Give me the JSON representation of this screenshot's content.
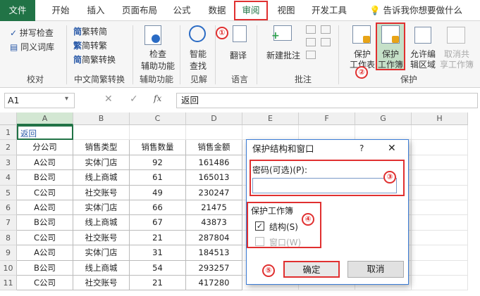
{
  "tabs": [
    "文件",
    "开始",
    "插入",
    "页面布局",
    "公式",
    "数据",
    "审阅",
    "视图",
    "开发工具"
  ],
  "tell_me": "告诉我你想要做什么",
  "ribbon": {
    "proofing": {
      "spell": "拼写检查",
      "thesaurus": "同义词库",
      "group": "校对"
    },
    "chinese": {
      "to_simplified": "繁转简",
      "to_traditional": "简转繁",
      "convert": "简繁转换",
      "group": "中文简繁转换"
    },
    "accessibility": {
      "label1": "检查",
      "label2": "辅助功能",
      "group": "辅助功能"
    },
    "insights": {
      "label1": "智能",
      "label2": "查找",
      "group": "见解"
    },
    "language": {
      "label": "翻译",
      "group": "语言"
    },
    "comments": {
      "label": "新建批注",
      "group": "批注"
    },
    "protect": {
      "sheet1": "保护",
      "sheet2": "工作表",
      "book1": "保护",
      "book2": "工作簿",
      "range1": "允许编",
      "range2": "辑区域",
      "unshare1": "取消共",
      "unshare2": "享工作簿",
      "group": "保护"
    }
  },
  "annotations": {
    "c1": "①",
    "c2": "②",
    "c3": "③",
    "c4": "④",
    "c5": "⑤"
  },
  "formula_bar": {
    "name_box": "A1",
    "fx": "fx",
    "value": "返回"
  },
  "columns": [
    "A",
    "B",
    "C",
    "D",
    "E",
    "F",
    "G",
    "H"
  ],
  "rows": [
    [
      "1",
      "返回",
      "",
      "",
      ""
    ],
    [
      "2",
      "分公司",
      "销售类型",
      "销售数量",
      "销售金额"
    ],
    [
      "3",
      "A公司",
      "实体门店",
      "92",
      "161486"
    ],
    [
      "4",
      "B公司",
      "线上商城",
      "61",
      "165013"
    ],
    [
      "5",
      "C公司",
      "社交账号",
      "49",
      "230247"
    ],
    [
      "6",
      "A公司",
      "实体门店",
      "66",
      "21475"
    ],
    [
      "7",
      "B公司",
      "线上商城",
      "67",
      "43873"
    ],
    [
      "8",
      "C公司",
      "社交账号",
      "21",
      "287804"
    ],
    [
      "9",
      "A公司",
      "实体门店",
      "31",
      "184513"
    ],
    [
      "10",
      "B公司",
      "线上商城",
      "54",
      "293257"
    ],
    [
      "11",
      "C公司",
      "社交账号",
      "21",
      "417280"
    ]
  ],
  "dialog": {
    "title": "保护结构和窗口",
    "help": "?",
    "close": "✕",
    "password_label": "密码(可选)(P):",
    "password_value": "",
    "protect_label": "保护工作簿",
    "structure": "结构(S)",
    "windows": "窗口(W)",
    "ok": "确定",
    "cancel": "取消"
  }
}
